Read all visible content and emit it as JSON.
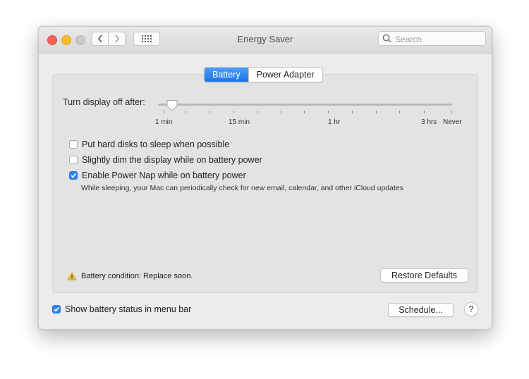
{
  "window": {
    "title": "Energy Saver"
  },
  "search": {
    "placeholder": "Search"
  },
  "tabs": [
    {
      "label": "Battery",
      "active": true
    },
    {
      "label": "Power Adapter",
      "active": false
    }
  ],
  "slider": {
    "label": "Turn display off after:",
    "tick_labels": [
      "1 min",
      "15 min",
      "1 hr",
      "3 hrs",
      "Never"
    ],
    "selected": "1 min"
  },
  "options": [
    {
      "label": "Put hard disks to sleep when possible",
      "checked": false
    },
    {
      "label": "Slightly dim the display while on battery power",
      "checked": false
    },
    {
      "label": "Enable Power Nap while on battery power",
      "checked": true
    }
  ],
  "power_nap_description": "While sleeping, your Mac can periodically check for new email, calendar, and other iCloud updates",
  "battery_condition": "Battery condition: Replace soon.",
  "buttons": {
    "restore_defaults": "Restore Defaults",
    "schedule": "Schedule...",
    "help": "?"
  },
  "show_battery_status": {
    "label": "Show battery status in menu bar",
    "checked": true
  },
  "colors": {
    "accent": "#1a73ea",
    "warning": "#f3c23c"
  },
  "icons": [
    "chevron-left-icon",
    "chevron-right-icon",
    "grid-icon",
    "search-icon",
    "warning-icon",
    "checkmark-icon",
    "help-icon"
  ]
}
